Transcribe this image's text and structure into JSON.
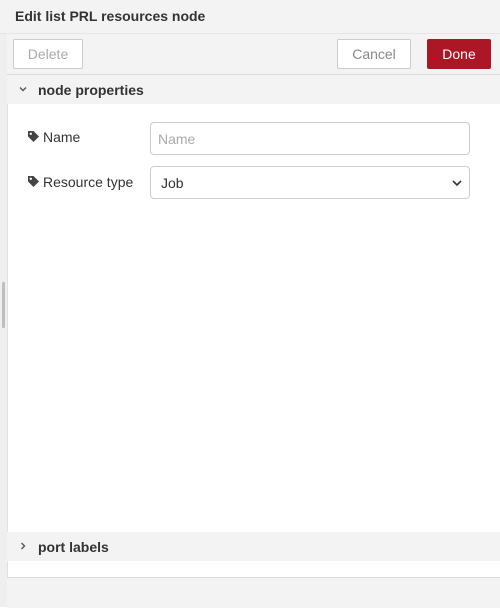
{
  "tray": {
    "title": "Edit list PRL resources node"
  },
  "toolbar": {
    "delete_label": "Delete",
    "cancel_label": "Cancel",
    "done_label": "Done"
  },
  "sections": {
    "node_properties": {
      "label": "node properties",
      "expanded": true
    },
    "port_labels": {
      "label": "port labels",
      "expanded": false
    }
  },
  "form": {
    "name": {
      "label": "Name",
      "value": "",
      "placeholder": "Name"
    },
    "resource_type": {
      "label": "Resource type",
      "value": "Job"
    }
  },
  "icons": {
    "tag": "tag-icon",
    "expand": "chevron-down-icon",
    "collapse": "chevron-right-icon",
    "select_caret": "chevron-down-icon"
  },
  "colors": {
    "primary": "#ad1625"
  }
}
